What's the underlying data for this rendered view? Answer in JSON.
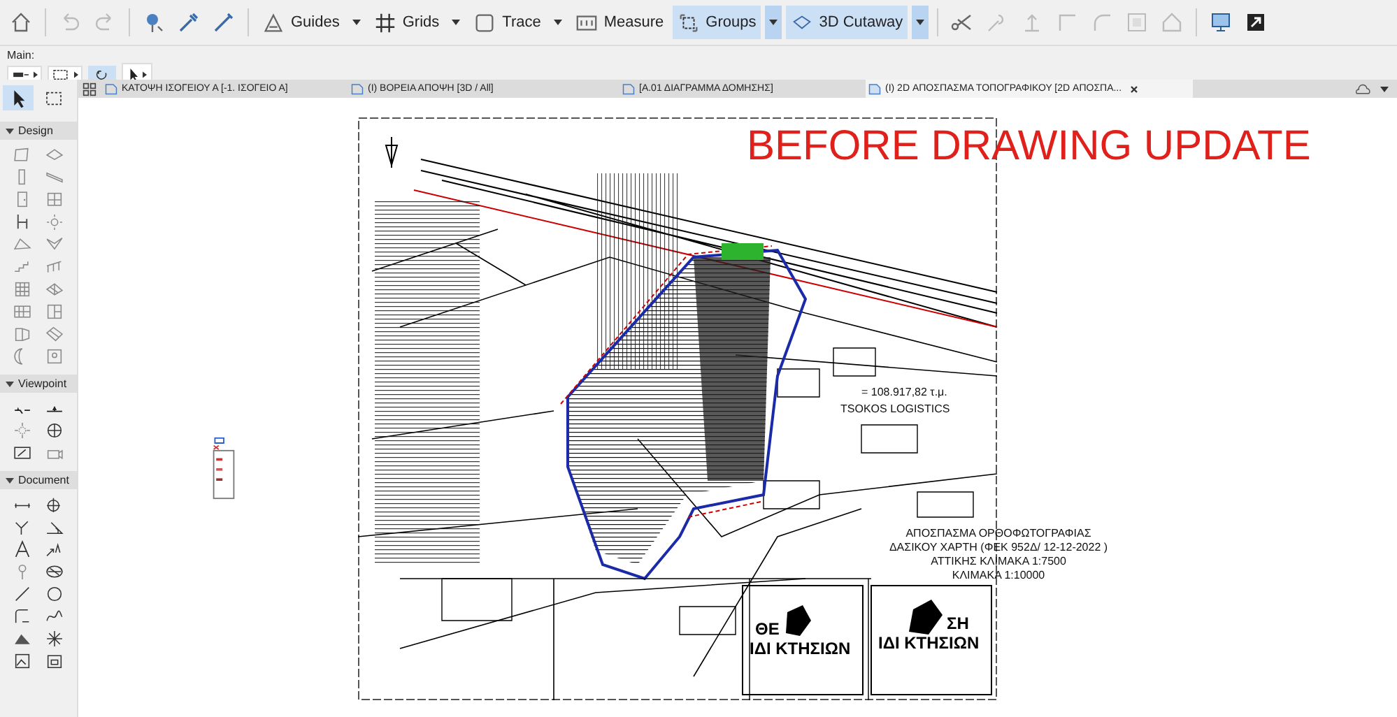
{
  "toolbar": {
    "buttons": [
      {
        "label": "Guides",
        "dropdown": true,
        "selected": false
      },
      {
        "label": "Grids",
        "dropdown": true,
        "selected": false
      },
      {
        "label": "Trace",
        "dropdown": true,
        "selected": false
      },
      {
        "label": "Measure",
        "dropdown": false,
        "selected": false
      },
      {
        "label": "Groups",
        "dropdown": true,
        "selected": true
      },
      {
        "label": "3D Cutaway",
        "dropdown": true,
        "selected": true
      }
    ]
  },
  "info_box": {
    "label": "Main:",
    "rotate_selected": true
  },
  "tabs": [
    {
      "label": "ΚΑΤΟΨΗ ΙΣΟΓΕΙΟΥ Α [-1. ΙΣΟΓΕΙΟ Α]",
      "selected": false
    },
    {
      "label": "(I) ΒΟΡΕΙΑ ΑΠΟΨΗ [3D / All]",
      "selected": false
    },
    {
      "label": "[Α.01 ΔΙΑΓΡΑΜΜΑ ΔΟΜΗΣΗΣ]",
      "selected": false
    },
    {
      "label": "(I) 2D ΑΠΟΣΠΑΣΜΑ ΤΟΠΟΓΡΑΦΙΚΟΥ [2D ΑΠΟΣΠΑ...",
      "selected": true
    }
  ],
  "toolbox": {
    "top_tools": [
      {
        "selected": true
      },
      {
        "selected": false
      }
    ],
    "sections": [
      {
        "title": "Design",
        "expanded": true
      },
      {
        "title": "Viewpoint",
        "expanded": true
      },
      {
        "title": "Document",
        "expanded": true
      }
    ]
  },
  "drawing": {
    "overlay_text": "BEFORE DRAWING UPDATE",
    "area_note": "= 108.917,82 τ.μ.",
    "site_label": "TSOKOS LOGISTICS",
    "title_lines": [
      "ΑΠΟΣΠΑΣΜΑ ΟΡΘΟΦΩΤΟΓΡΑΦΙΑΣ",
      "ΔΑΣΙΚΟΥ ΧΑΡΤΗ (ΦΕΚ 952Δ/ 12-12-2022 )",
      "ΑΤΤΙΚΗΣ ΚΛΙΜΑΚΑ 1:7500",
      "ΚΛΙΜΑΚΑ 1:10000"
    ],
    "legend_boxes": [
      {
        "lines": [
          "ΘΕ",
          "ΙΔΙ ΚΤΗΣΙΩΝ"
        ]
      },
      {
        "lines": [
          "ΣΗ",
          "ΙΔΙ ΚΤΗΣΙΩΝ"
        ]
      }
    ]
  }
}
